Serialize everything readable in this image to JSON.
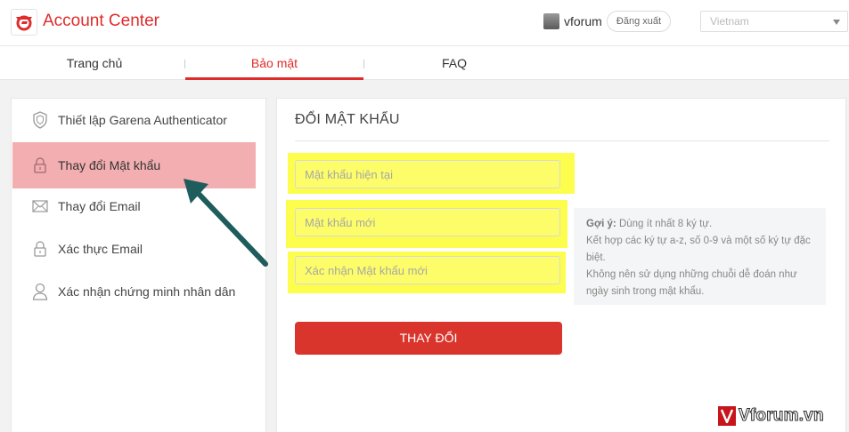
{
  "header": {
    "title": "Account Center",
    "username": "vforum",
    "logout_label": "Đăng xuất",
    "region_value": "Vietnam",
    "brand_color": "#e02b2b"
  },
  "tabs": [
    {
      "label": "Trang chủ",
      "active": false
    },
    {
      "label": "Bảo mật",
      "active": true
    },
    {
      "label": "FAQ",
      "active": false
    }
  ],
  "sidebar": {
    "items": [
      {
        "label": "Thiết lập Garena Authenticator",
        "icon": "shield-icon"
      },
      {
        "label": "Thay đổi Mật khẩu",
        "icon": "lock-icon",
        "active": true
      },
      {
        "label": "Thay đổi Email",
        "icon": "envelope-icon"
      },
      {
        "label": "Xác thực Email",
        "icon": "lock-icon"
      },
      {
        "label": "Xác nhận chứng minh nhân dân",
        "icon": "user-icon"
      }
    ]
  },
  "form": {
    "title": "ĐỔI MẬT KHẨU",
    "current_password_placeholder": "Mật khẩu hiện tại",
    "new_password_placeholder": "Mật khẩu mới",
    "confirm_password_placeholder": "Xác nhận Mật khẩu mới",
    "submit_label": "THAY ĐỔI",
    "highlight_color": "#fdfd4e"
  },
  "hint": {
    "heading": "Gợi ý:",
    "line1": " Dùng ít nhất 8 ký tự.",
    "line2": "Kết hợp các ký tự a-z, số 0-9 và một số ký tự đặc biệt.",
    "line3": "Không nên sử dụng những chuỗi dễ đoán như ngày sinh trong mật khẩu."
  },
  "watermark": {
    "text": "Vforum.vn"
  }
}
